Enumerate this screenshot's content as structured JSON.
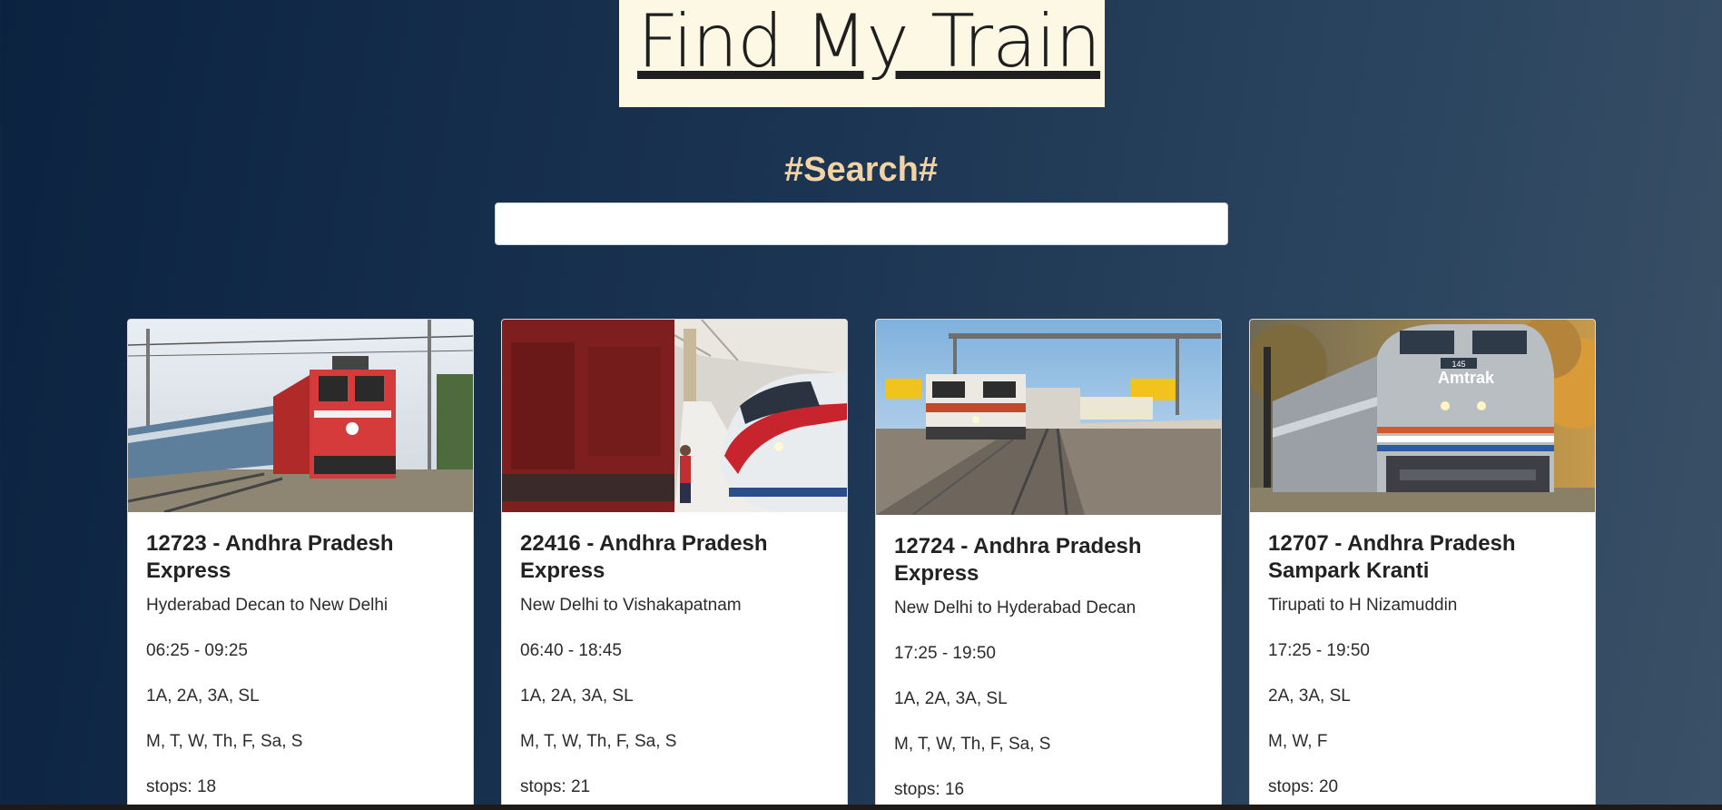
{
  "header": {
    "title": "Find My Train"
  },
  "search": {
    "heading": "#Search#",
    "value": "",
    "placeholder": ""
  },
  "trains": [
    {
      "title": "12723 - Andhra Pradesh Express",
      "route": "Hyderabad Decan to New Delhi",
      "time": "06:25 - 09:25",
      "classes": "1A, 2A, 3A, SL",
      "days": "M, T, W, Th, F, Sa, S",
      "stops": "stops: 18",
      "image": "red-electric-locomotive-photo"
    },
    {
      "title": "22416 - Andhra Pradesh Express",
      "route": "New Delhi to Vishakapatnam",
      "time": "06:40 - 18:45",
      "classes": "1A, 2A, 3A, SL",
      "days": "M, T, W, Th, F, Sa, S",
      "stops": "stops: 21",
      "image": "high-speed-train-station-photo"
    },
    {
      "title": "12724 - Andhra Pradesh Express",
      "route": "New Delhi to Hyderabad Decan",
      "time": "17:25 - 19:50",
      "classes": "1A, 2A, 3A, SL",
      "days": "M, T, W, Th, F, Sa, S",
      "stops": "stops: 16",
      "image": "white-locomotive-platform-photo"
    },
    {
      "title": "12707 - Andhra Pradesh Sampark Kranti",
      "route": "Tirupati to H Nizamuddin",
      "time": "17:25 - 19:50",
      "classes": "2A, 3A, SL",
      "days": "M, W, F",
      "stops": "stops: 20",
      "image": "amtrak-locomotive-photo",
      "image_text": "Amtrak"
    }
  ]
}
